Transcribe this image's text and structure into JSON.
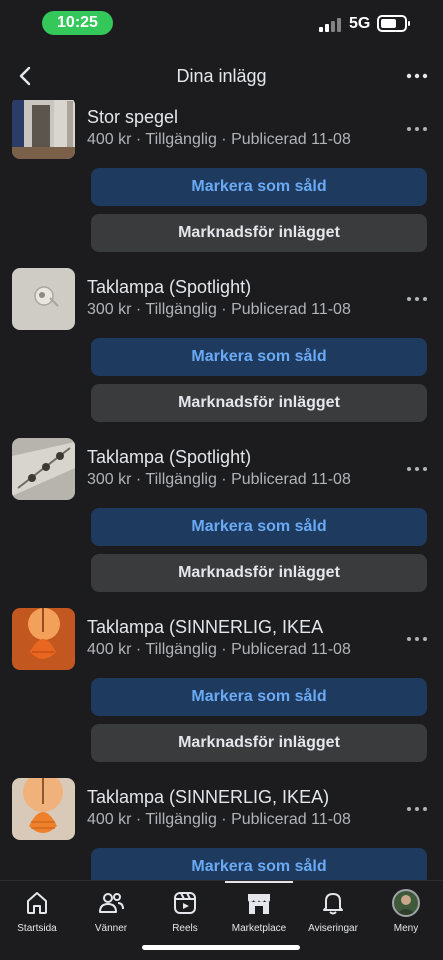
{
  "status_bar": {
    "time": "10:25",
    "network": "5G"
  },
  "header": {
    "title": "Dina inlägg"
  },
  "listings": [
    {
      "title": "Stor spegel",
      "meta": "400 kr · Tillgänglig · Publicerad 11-08",
      "thumb": "mirror"
    },
    {
      "title": "Taklampa (Spotlight)",
      "meta": "300 kr · Tillgänglig · Publicerad 11-08",
      "thumb": "spot1"
    },
    {
      "title": "Taklampa (Spotlight)",
      "meta": "300 kr · Tillgänglig · Publicerad 11-08",
      "thumb": "spot2"
    },
    {
      "title": "Taklampa (SINNERLIG, IKEA",
      "meta": "400 kr · Tillgänglig · Publicerad 11-08",
      "thumb": "orange"
    },
    {
      "title": "Taklampa (SINNERLIG, IKEA)",
      "meta": "400 kr · Tillgänglig · Publicerad 11-08",
      "thumb": "orange"
    }
  ],
  "actions": {
    "mark_sold": "Markera som såld",
    "promote": "Marknadsför inlägget"
  },
  "tabs": [
    {
      "label": "Startsida",
      "icon": "home-icon"
    },
    {
      "label": "Vänner",
      "icon": "friends-icon"
    },
    {
      "label": "Reels",
      "icon": "reels-icon"
    },
    {
      "label": "Marketplace",
      "icon": "marketplace-icon",
      "active": true
    },
    {
      "label": "Aviseringar",
      "icon": "bell-icon"
    },
    {
      "label": "Meny",
      "icon": "avatar-icon"
    }
  ],
  "colors": {
    "background": "#1c1c1e",
    "primary_button": "#1f3a5f",
    "primary_text": "#6aaaf4",
    "secondary_button": "#3a3b3c",
    "time_pill": "#34c759"
  }
}
